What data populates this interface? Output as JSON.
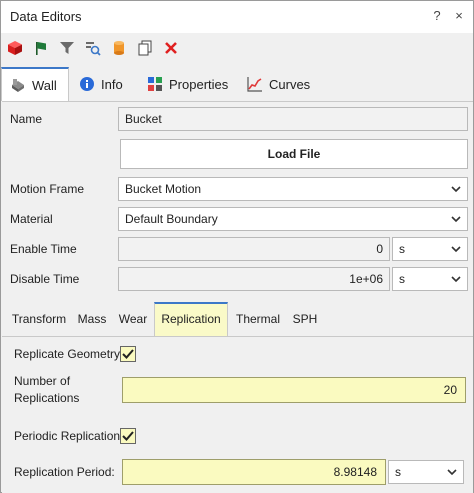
{
  "window": {
    "title": "Data Editors",
    "help": "?",
    "close": "×"
  },
  "toolbar": {
    "icons": [
      "red-cube-icon",
      "green-flag-icon",
      "filter-icon",
      "search-settings-icon",
      "cylinder-icon",
      "copy-icon",
      "delete-x-icon"
    ]
  },
  "tabs": [
    {
      "label": "Wall",
      "icon": "wall-icon"
    },
    {
      "label": "Info",
      "icon": "info-icon"
    },
    {
      "label": "Properties",
      "icon": "properties-icon"
    },
    {
      "label": "Curves",
      "icon": "curves-icon"
    }
  ],
  "form": {
    "name_label": "Name",
    "name_value": "Bucket",
    "load_file": "Load File",
    "motion_label": "Motion Frame",
    "motion_value": "Bucket Motion",
    "material_label": "Material",
    "material_value": "Default Boundary",
    "enable_label": "Enable Time",
    "enable_value": "0",
    "enable_unit": "s",
    "disable_label": "Disable Time",
    "disable_value": "1e+06",
    "disable_unit": "s"
  },
  "subtabs": [
    "Transform",
    "Mass",
    "Wear",
    "Replication",
    "Thermal",
    "SPH"
  ],
  "replication": {
    "replicate_label": "Replicate Geometry",
    "number_label_1": "Number of",
    "number_label_2": "Replications",
    "number_value": "20",
    "periodic_label": "Periodic Replication",
    "period_label": "Replication Period:",
    "period_value": "8.98148",
    "period_unit": "s"
  },
  "colors": {
    "accent": "#3c78c8",
    "highlight": "#fafac0"
  }
}
